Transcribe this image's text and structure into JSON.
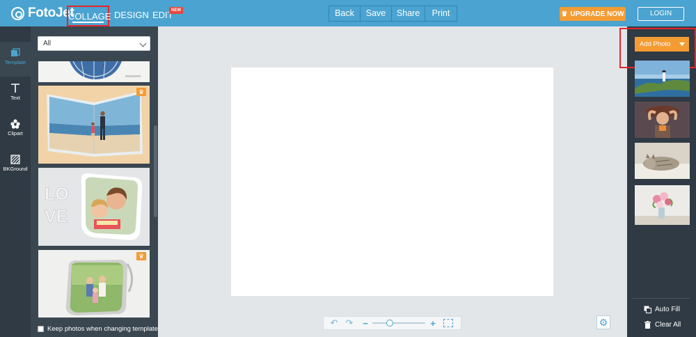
{
  "app": {
    "logo_text": "FotoJet"
  },
  "nav": {
    "collage": "COLLAGE",
    "design": "DESIGN",
    "edit": "EDIT",
    "new_badge": "NEW"
  },
  "actions": {
    "back": "Back",
    "save": "Save",
    "share": "Share",
    "print": "Print"
  },
  "account": {
    "upgrade": "UPGRADE NOW",
    "login": "LOGIN"
  },
  "rail": {
    "items": [
      {
        "label": "Template",
        "icon": "template-icon"
      },
      {
        "label": "Text",
        "icon": "text-icon"
      },
      {
        "label": "Clipart",
        "icon": "clipart-icon"
      },
      {
        "label": "BKGround",
        "icon": "background-icon"
      }
    ]
  },
  "templates": {
    "filter_value": "All",
    "keep_photos_label": "Keep photos when changing template",
    "items": [
      {
        "name": "globe",
        "premium": false
      },
      {
        "name": "beach-fold",
        "premium": true
      },
      {
        "name": "love-kids",
        "premium": false
      },
      {
        "name": "family-park",
        "premium": true
      }
    ]
  },
  "zoom": {
    "level_fraction": 0.33
  },
  "photos": {
    "add_label": "Add Photo",
    "thumbnails": [
      "lighthouse-coast",
      "woman-hat",
      "cat-sleeping",
      "flower-vase"
    ],
    "auto_fill": "Auto Fill",
    "clear_all": "Clear All"
  },
  "colors": {
    "brand_blue": "#4aa3d0",
    "accent_orange": "#f39c34",
    "dark_panel": "#2f3a44",
    "highlight_red": "#e3262b"
  }
}
